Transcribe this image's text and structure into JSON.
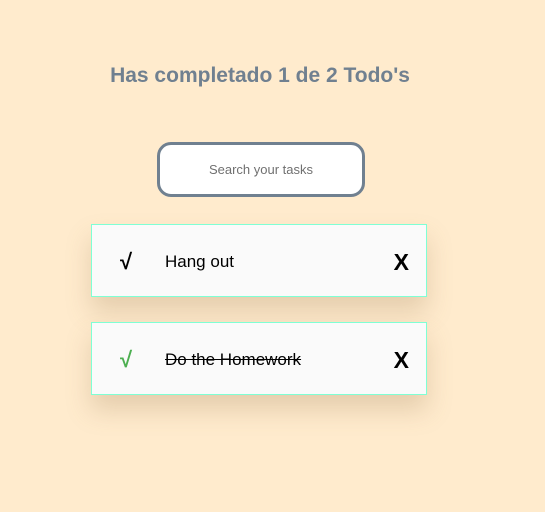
{
  "header": {
    "title": "Has completado 1 de 2 Todo's"
  },
  "search": {
    "placeholder": "Search your tasks",
    "value": ""
  },
  "todos": [
    {
      "text": "Hang out",
      "completed": false,
      "check_icon": "√",
      "delete_icon": "X",
      "check_color": "#000000"
    },
    {
      "text": "Do the Homework",
      "completed": true,
      "check_icon": "√",
      "delete_icon": "X",
      "check_color": "#4caf50"
    }
  ]
}
